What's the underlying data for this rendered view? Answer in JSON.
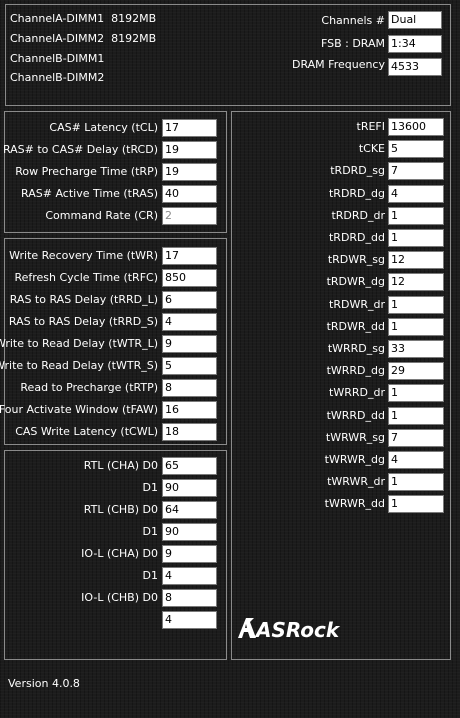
{
  "dimms": [
    "ChannelA-DIMM1  8192MB",
    "ChannelA-DIMM2  8192MB",
    "ChannelB-DIMM1",
    "ChannelB-DIMM2"
  ],
  "summary": [
    {
      "label": "Channels #",
      "value": "Dual"
    },
    {
      "label": "FSB : DRAM",
      "value": "1:34"
    },
    {
      "label": "DRAM Frequency",
      "value": "4533"
    }
  ],
  "primary": [
    {
      "label": "CAS# Latency (tCL)",
      "value": "17"
    },
    {
      "label": "RAS# to CAS# Delay (tRCD)",
      "value": "19"
    },
    {
      "label": "Row Precharge Time (tRP)",
      "value": "19"
    },
    {
      "label": "RAS# Active Time (tRAS)",
      "value": "40"
    },
    {
      "label": "Command Rate (CR)",
      "value": "2"
    }
  ],
  "secondary": [
    {
      "label": "Write Recovery Time (tWR)",
      "value": "17"
    },
    {
      "label": "Refresh Cycle Time (tRFC)",
      "value": "850"
    },
    {
      "label": "RAS to RAS Delay (tRRD_L)",
      "value": "6"
    },
    {
      "label": "RAS to RAS Delay (tRRD_S)",
      "value": "4"
    },
    {
      "label": "Write to Read Delay (tWTR_L)",
      "value": "9"
    },
    {
      "label": "Write to Read Delay (tWTR_S)",
      "value": "5"
    },
    {
      "label": "Read to Precharge (tRTP)",
      "value": "8"
    },
    {
      "label": "Four Activate Window (tFAW)",
      "value": "16"
    },
    {
      "label": "CAS Write Latency (tCWL)",
      "value": "18"
    }
  ],
  "rtl": [
    {
      "label": "RTL (CHA) D0",
      "value": "65"
    },
    {
      "label": "D1",
      "value": "90"
    },
    {
      "label": "RTL (CHB) D0",
      "value": "64"
    },
    {
      "label": "D1",
      "value": "90"
    },
    {
      "label": "IO-L (CHA) D0",
      "value": "9"
    },
    {
      "label": "D1",
      "value": "4"
    },
    {
      "label": "IO-L (CHB) D0",
      "value": "8"
    },
    {
      "label": "",
      "value": "4"
    }
  ],
  "tertiary": [
    {
      "label": "tREFI",
      "value": "13600"
    },
    {
      "label": "tCKE",
      "value": "5"
    },
    {
      "label": "tRDRD_sg",
      "value": "7"
    },
    {
      "label": "tRDRD_dg",
      "value": "4"
    },
    {
      "label": "tRDRD_dr",
      "value": "1"
    },
    {
      "label": "tRDRD_dd",
      "value": "1"
    },
    {
      "label": "tRDWR_sg",
      "value": "12"
    },
    {
      "label": "tRDWR_dg",
      "value": "12"
    },
    {
      "label": "tRDWR_dr",
      "value": "1"
    },
    {
      "label": "tRDWR_dd",
      "value": "1"
    },
    {
      "label": "tWRRD_sg",
      "value": "33"
    },
    {
      "label": "tWRRD_dg",
      "value": "29"
    },
    {
      "label": "tWRRD_dr",
      "value": "1"
    },
    {
      "label": "tWRRD_dd",
      "value": "1"
    },
    {
      "label": "tWRWR_sg",
      "value": "7"
    },
    {
      "label": "tWRWR_dg",
      "value": "4"
    },
    {
      "label": "tWRWR_dr",
      "value": "1"
    },
    {
      "label": "tWRWR_dd",
      "value": "1"
    }
  ],
  "logo_text": "ASRock",
  "version": "Version 4.0.8"
}
